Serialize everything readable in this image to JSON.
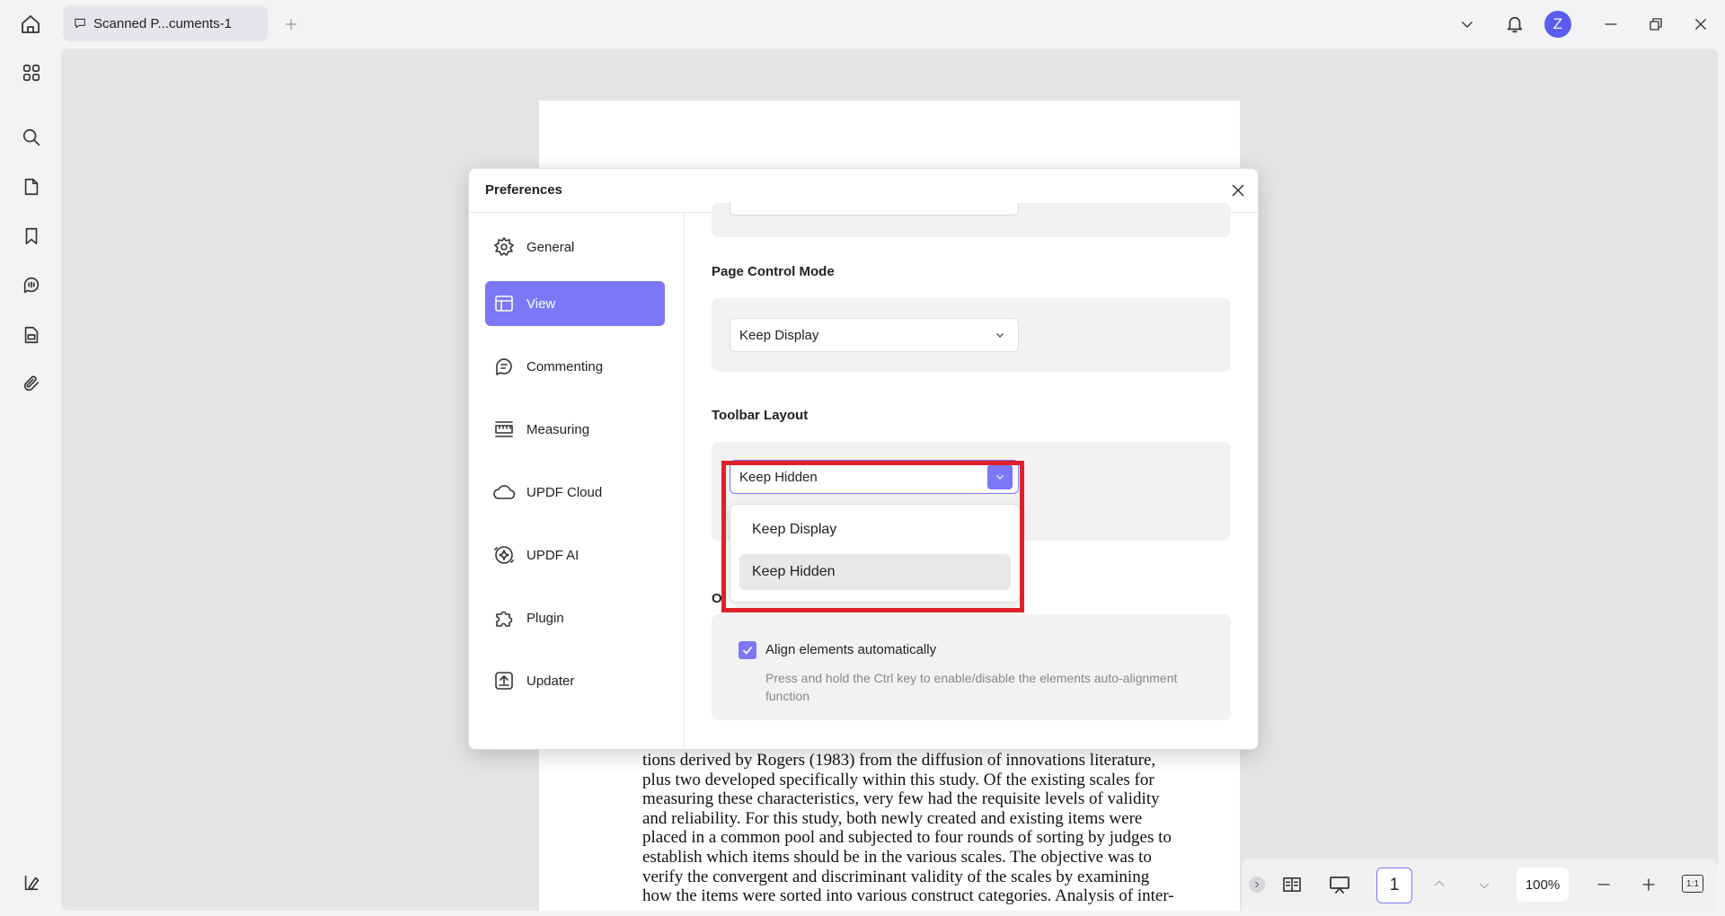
{
  "titlebar": {
    "tab_label": "Scanned P...cuments-1",
    "avatar_letter": "Z"
  },
  "document": {
    "lines": [
      "tions derived by Rogers (1983) from the diffusion of innovations literature,",
      "plus two developed specifically within this study. Of the existing scales for",
      "measuring these characteristics, very few had the requisite levels of validity",
      "and reliability. For this study, both newly created and existing items were",
      "placed in a common pool and subjected to four rounds of sorting by judges to",
      "establish which items should be in the various scales. The objective was to",
      "verify the convergent and discriminant validity of the scales by examining",
      "how the items were sorted into various construct categories. Analysis of inter-"
    ]
  },
  "bottombar": {
    "page_number": "1",
    "zoom": "100%",
    "fit_label": "1:1"
  },
  "dialog": {
    "title": "Preferences",
    "nav": [
      {
        "label": "General",
        "icon": "gear-icon"
      },
      {
        "label": "View",
        "icon": "layout-icon",
        "active": true
      },
      {
        "label": "Commenting",
        "icon": "comment-icon"
      },
      {
        "label": "Measuring",
        "icon": "ruler-icon"
      },
      {
        "label": "UPDF Cloud",
        "icon": "cloud-icon"
      },
      {
        "label": "UPDF AI",
        "icon": "ai-icon"
      },
      {
        "label": "Plugin",
        "icon": "puzzle-icon"
      },
      {
        "label": "Updater",
        "icon": "update-icon"
      }
    ],
    "page_control": {
      "label": "Page Control Mode",
      "value": "Keep Display"
    },
    "toolbar_layout": {
      "label": "Toolbar Layout",
      "value": "Keep Hidden",
      "options": [
        "Keep Display",
        "Keep Hidden"
      ],
      "selected_index": 1
    },
    "other": {
      "label_partial": "O",
      "align_label": "Align elements automatically",
      "align_checked": true,
      "align_desc_1": "Press and hold the Ctrl key to enable/disable the elements auto-alignment",
      "align_desc_2": "function"
    }
  },
  "colors": {
    "accent": "#7b77f7",
    "highlight": "#e0202a"
  }
}
